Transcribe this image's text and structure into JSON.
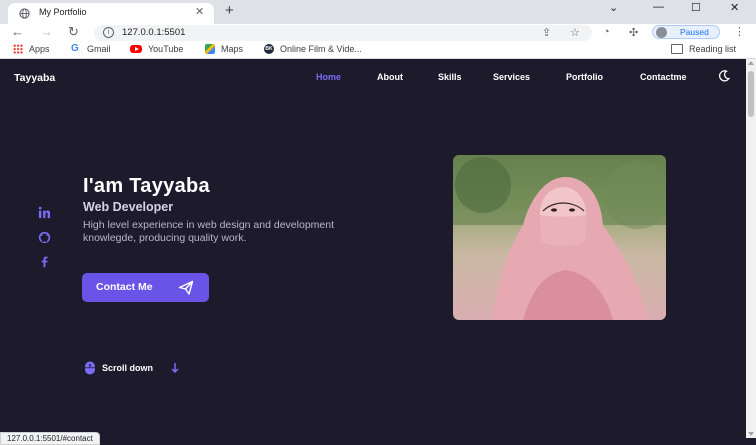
{
  "browser": {
    "tab_title": "My Portfolio",
    "url": "127.0.0.1:5501",
    "profile_label": "Paused",
    "bookmarks": [
      {
        "label": "Apps",
        "icon": "apps-grid-icon"
      },
      {
        "label": "Gmail",
        "icon": "google-icon"
      },
      {
        "label": "YouTube",
        "icon": "youtube-icon"
      },
      {
        "label": "Maps",
        "icon": "maps-icon"
      },
      {
        "label": "Online Film & Vide...",
        "icon": "bk-site-icon"
      }
    ],
    "reading_list": "Reading list",
    "status_url": "127.0.0.1:5501/#contact"
  },
  "site": {
    "logo": "Tayyaba",
    "nav": [
      "Home",
      "About",
      "Skills",
      "Services",
      "Portfolio",
      "Contactme"
    ],
    "active_nav": "Home",
    "accent_color": "#6a54e8",
    "background_color": "#1c1a2b"
  },
  "hero": {
    "title": "I'am Tayyaba",
    "subtitle": "Web Developer",
    "description": "High level experience in web design and development knowlegde, producing quality work.",
    "cta_label": "Contact Me",
    "scroll_label": "Scroll down",
    "social": [
      "linkedin-icon",
      "github-icon",
      "facebook-icon"
    ]
  }
}
